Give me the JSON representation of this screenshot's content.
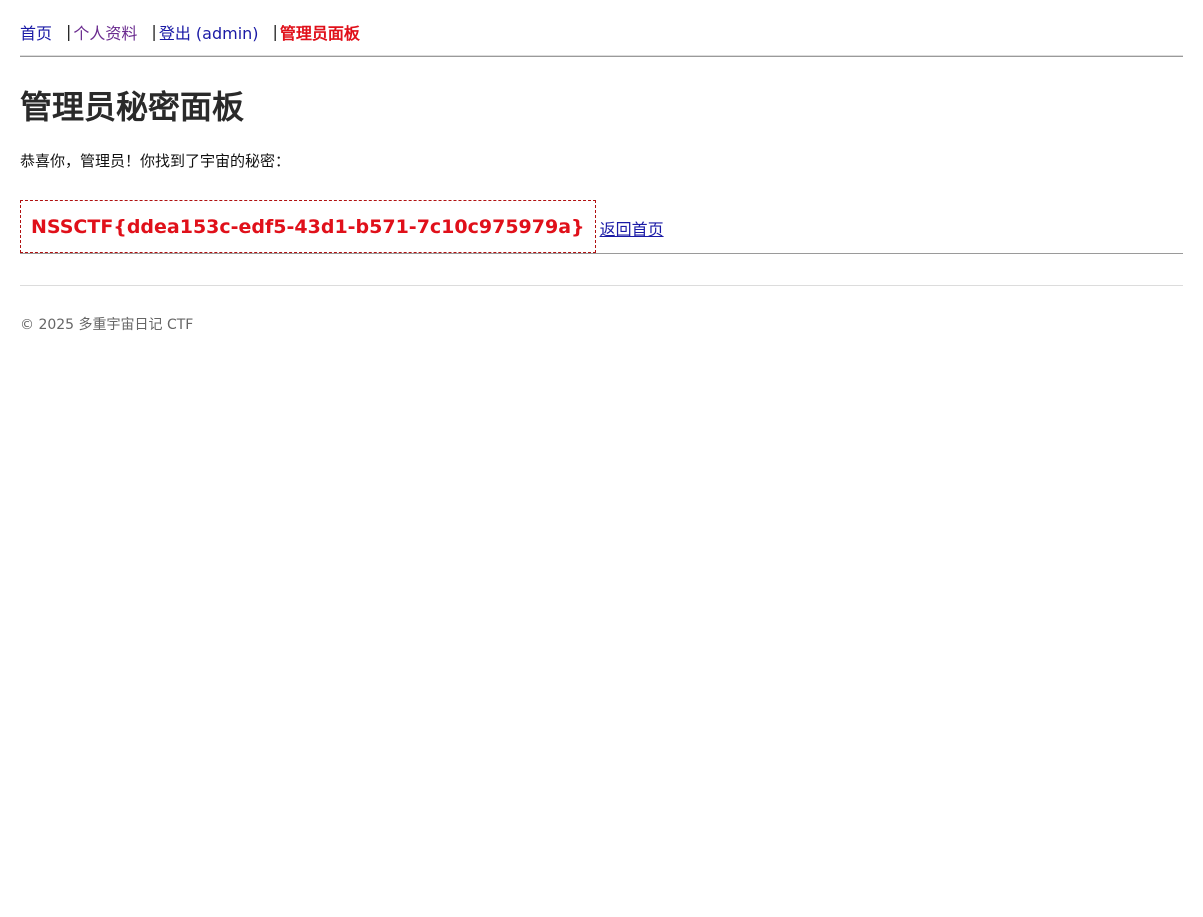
{
  "nav": {
    "home": "首页",
    "separator": "|",
    "profile": "个人资料",
    "logout": "登出 (admin)",
    "admin_panel": "管理员面板"
  },
  "main": {
    "title": "管理员秘密面板",
    "intro": "恭喜你，管理员！你找到了宇宙的秘密：",
    "flag": "NSSCTF{ddea153c-edf5-43d1-b571-7c10c975979a}",
    "back_link": "返回首页"
  },
  "footer": {
    "copyright": "© 2025 多重宇宙日记 CTF"
  },
  "colors": {
    "link": "#1a1aa6",
    "visited_link": "#6a2b8f",
    "active_nav": "#e0101a",
    "flag": "#e0101a"
  }
}
